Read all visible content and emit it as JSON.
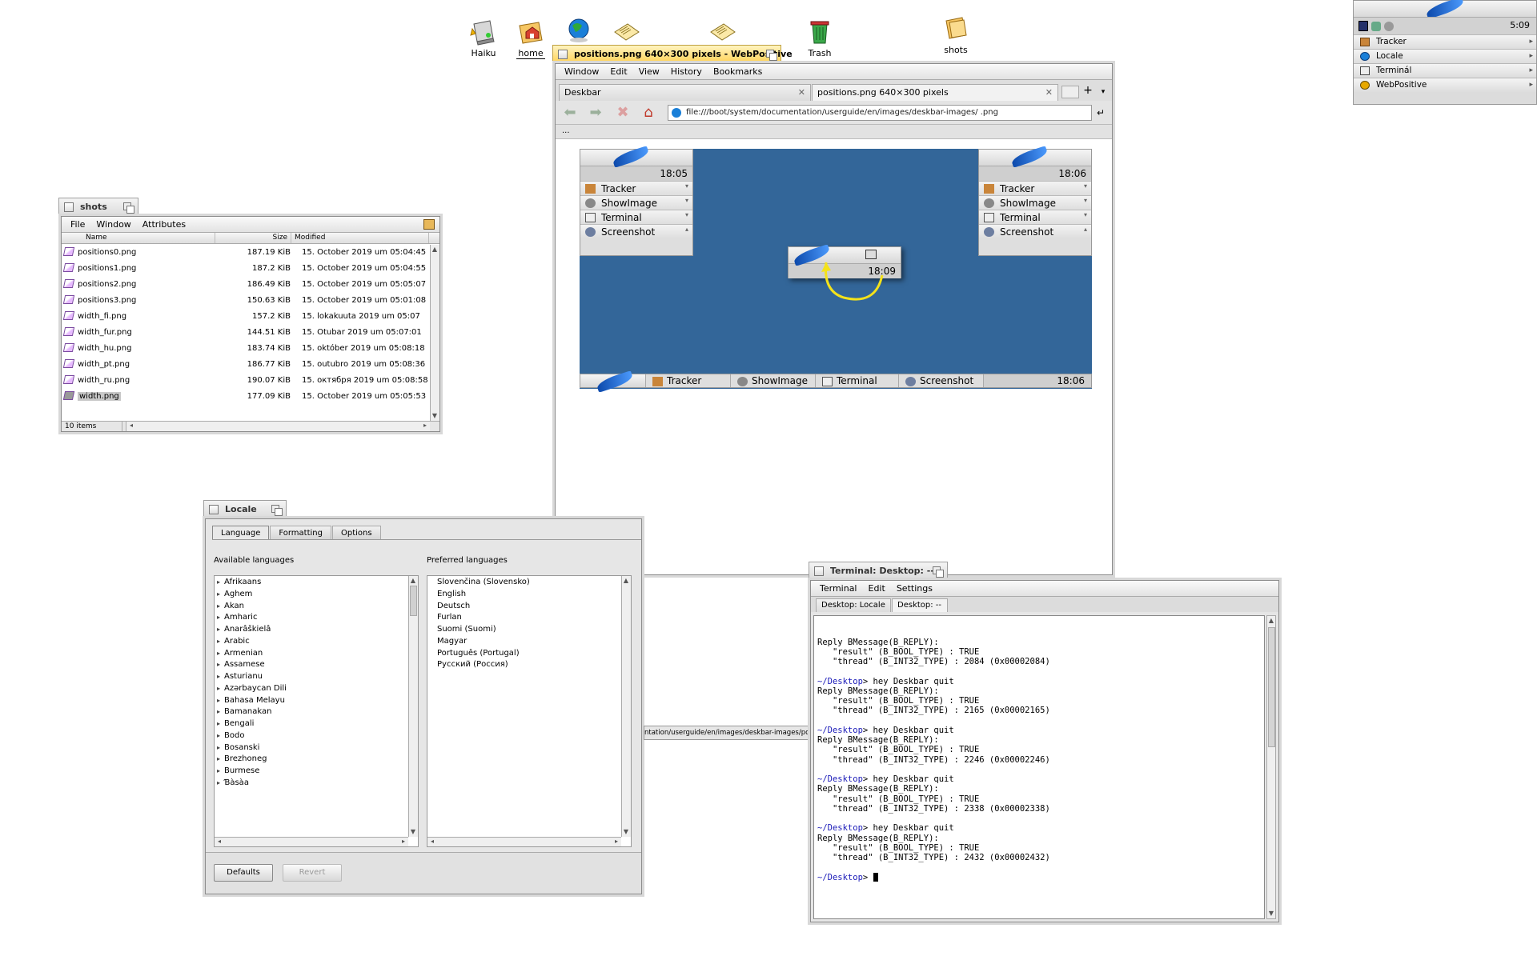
{
  "desktop": {
    "icons": [
      {
        "label": "Haiku"
      },
      {
        "label": "home"
      },
      {
        "label": "Trash"
      },
      {
        "label": "shots"
      }
    ]
  },
  "deskbar": {
    "clock": "5:09",
    "items": [
      {
        "label": "Tracker",
        "icon": "tracker-icon"
      },
      {
        "label": "Locale",
        "icon": "globe-icon"
      },
      {
        "label": "Terminál",
        "icon": "terminal-icon"
      },
      {
        "label": "WebPositive",
        "icon": "webpositive-icon"
      }
    ]
  },
  "shots_window": {
    "title": "shots",
    "menu": [
      "File",
      "Window",
      "Attributes"
    ],
    "columns": {
      "name": "Name",
      "size": "Size",
      "modified": "Modified"
    },
    "files": [
      {
        "name": "positions0.png",
        "size": "187.19 KiB",
        "modified": "15. October 2019 um 05:04:45"
      },
      {
        "name": "positions1.png",
        "size": "187.2 KiB",
        "modified": "15. October 2019 um 05:04:55"
      },
      {
        "name": "positions2.png",
        "size": "186.49 KiB",
        "modified": "15. October 2019 um 05:05:07"
      },
      {
        "name": "positions3.png",
        "size": "150.63 KiB",
        "modified": "15. October 2019 um 05:01:08"
      },
      {
        "name": "width_fi.png",
        "size": "157.2 KiB",
        "modified": "15. lokakuuta 2019 um 05:07"
      },
      {
        "name": "width_fur.png",
        "size": "144.51 KiB",
        "modified": "15. Otubar 2019 um 05:07:01"
      },
      {
        "name": "width_hu.png",
        "size": "183.74 KiB",
        "modified": "15. október 2019 um 05:08:18"
      },
      {
        "name": "width_pt.png",
        "size": "186.77 KiB",
        "modified": "15. outubro 2019 um 05:08:36"
      },
      {
        "name": "width_ru.png",
        "size": "190.07 KiB",
        "modified": "15. октября 2019 um 05:08:58"
      },
      {
        "name": "width.png",
        "size": "177.09 KiB",
        "modified": "15. October 2019 um 05:05:53"
      }
    ],
    "status": "10 items"
  },
  "browser": {
    "title": "positions.png 640×300 pixels - WebPositive",
    "menu": [
      "Window",
      "Edit",
      "View",
      "History",
      "Bookmarks"
    ],
    "tabs": [
      {
        "label": "Deskbar"
      },
      {
        "label": "positions.png 640×300 pixels"
      }
    ],
    "url": "file:///boot/system/documentation/userguide/en/images/deskbar-images/ .png",
    "bookmark_stub": "...",
    "status_url": "ntation/userguide/en/images/deskbar-images/position",
    "image": {
      "left_bar": {
        "clock": "18:05",
        "apps": [
          "Tracker",
          "ShowImage",
          "Terminal",
          "Screenshot"
        ]
      },
      "right_bar": {
        "clock": "18:06",
        "apps": [
          "Tracker",
          "ShowImage",
          "Terminal",
          "Screenshot"
        ]
      },
      "center_bar": {
        "clock": "18:09"
      },
      "bottom_bar": {
        "clock": "18:06",
        "apps": [
          "Tracker",
          "ShowImage",
          "Terminal",
          "Screenshot"
        ]
      }
    }
  },
  "locale_window": {
    "title": "Locale",
    "tabs": [
      "Language",
      "Formatting",
      "Options"
    ],
    "available_label": "Available languages",
    "preferred_label": "Preferred languages",
    "available": [
      "Afrikaans",
      "Aghem",
      "Akan",
      "Amharic",
      "Anarâškielâ",
      "Arabic",
      "Armenian",
      "Assamese",
      "Asturianu",
      "Azərbaycan Dili",
      "Bahasa Melayu",
      "Bamanakan",
      "Bengali",
      "Bodo",
      "Bosanski",
      "Brezhoneg",
      "Burmese",
      "Ɓàsàa"
    ],
    "preferred": [
      "Slovenčina (Slovensko)",
      "English",
      "Deutsch",
      "Furlan",
      "Suomi (Suomi)",
      "Magyar",
      "Português (Portugal)",
      "Русский (Россия)"
    ],
    "defaults_label": "Defaults",
    "revert_label": "Revert"
  },
  "terminal_window": {
    "title": "Terminal: Desktop: --",
    "menu": [
      "Terminal",
      "Edit",
      "Settings"
    ],
    "tabs": [
      "Desktop: Locale",
      "Desktop: --"
    ],
    "prompt_path": "~/Desktop",
    "lines": [
      {
        "t": "out",
        "text": "Reply BMessage(B_REPLY):"
      },
      {
        "t": "out",
        "text": "   \"result\" (B_BOOL_TYPE) : TRUE"
      },
      {
        "t": "out",
        "text": "   \"thread\" (B_INT32_TYPE) : 2084 (0x00002084)"
      },
      {
        "t": "out",
        "text": ""
      },
      {
        "t": "cmd",
        "text": "> hey Deskbar quit"
      },
      {
        "t": "out",
        "text": "Reply BMessage(B_REPLY):"
      },
      {
        "t": "out",
        "text": "   \"result\" (B_BOOL_TYPE) : TRUE"
      },
      {
        "t": "out",
        "text": "   \"thread\" (B_INT32_TYPE) : 2165 (0x00002165)"
      },
      {
        "t": "out",
        "text": ""
      },
      {
        "t": "cmd",
        "text": "> hey Deskbar quit"
      },
      {
        "t": "out",
        "text": "Reply BMessage(B_REPLY):"
      },
      {
        "t": "out",
        "text": "   \"result\" (B_BOOL_TYPE) : TRUE"
      },
      {
        "t": "out",
        "text": "   \"thread\" (B_INT32_TYPE) : 2246 (0x00002246)"
      },
      {
        "t": "out",
        "text": ""
      },
      {
        "t": "cmd",
        "text": "> hey Deskbar quit"
      },
      {
        "t": "out",
        "text": "Reply BMessage(B_REPLY):"
      },
      {
        "t": "out",
        "text": "   \"result\" (B_BOOL_TYPE) : TRUE"
      },
      {
        "t": "out",
        "text": "   \"thread\" (B_INT32_TYPE) : 2338 (0x00002338)"
      },
      {
        "t": "out",
        "text": ""
      },
      {
        "t": "cmd",
        "text": "> hey Deskbar quit"
      },
      {
        "t": "out",
        "text": "Reply BMessage(B_REPLY):"
      },
      {
        "t": "out",
        "text": "   \"result\" (B_BOOL_TYPE) : TRUE"
      },
      {
        "t": "out",
        "text": "   \"thread\" (B_INT32_TYPE) : 2432 (0x00002432)"
      },
      {
        "t": "out",
        "text": ""
      },
      {
        "t": "cmd",
        "text": "> "
      }
    ]
  },
  "colors": {
    "tab_active": "#ffd35a",
    "desktop_image_bg": "#336699",
    "prompt": "#1a1ab8"
  }
}
